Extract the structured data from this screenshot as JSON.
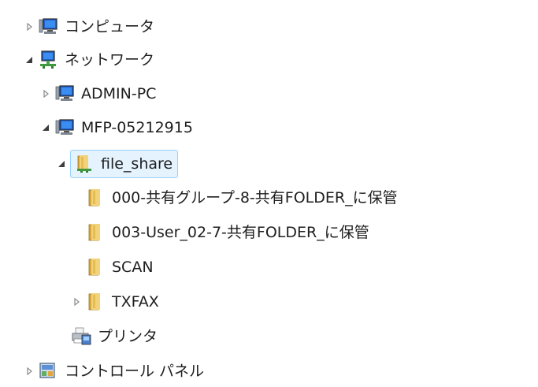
{
  "tree": {
    "computer": {
      "label": "コンピュータ",
      "icon": "computer-icon",
      "state": "collapsed"
    },
    "network": {
      "label": "ネットワーク",
      "icon": "network-icon",
      "state": "expanded"
    },
    "admin_pc": {
      "label": "ADMIN-PC",
      "icon": "computer-icon",
      "state": "collapsed"
    },
    "mfp": {
      "label": "MFP-05212915",
      "icon": "computer-icon",
      "state": "expanded"
    },
    "file_share": {
      "label": "file_share",
      "icon": "shared-folder-icon",
      "state": "expanded",
      "selected": true
    },
    "folder_000": {
      "label": "000-共有グループ-8-共有FOLDER_に保管",
      "icon": "folder-icon"
    },
    "folder_003": {
      "label": "003-User_02-7-共有FOLDER_に保管",
      "icon": "folder-icon"
    },
    "scan": {
      "label": "SCAN",
      "icon": "folder-icon"
    },
    "txfax": {
      "label": "TXFAX",
      "icon": "folder-icon",
      "state": "collapsed"
    },
    "printer": {
      "label": "プリンタ",
      "icon": "printer-icon"
    },
    "control_panel": {
      "label": "コントロール パネル",
      "icon": "control-panel-icon",
      "state": "collapsed"
    }
  },
  "colors": {
    "selection_bg": "#e5f3ff",
    "selection_border": "#99d1ff",
    "folder": "#e8c35a",
    "monitor": "#2a6fd6"
  }
}
